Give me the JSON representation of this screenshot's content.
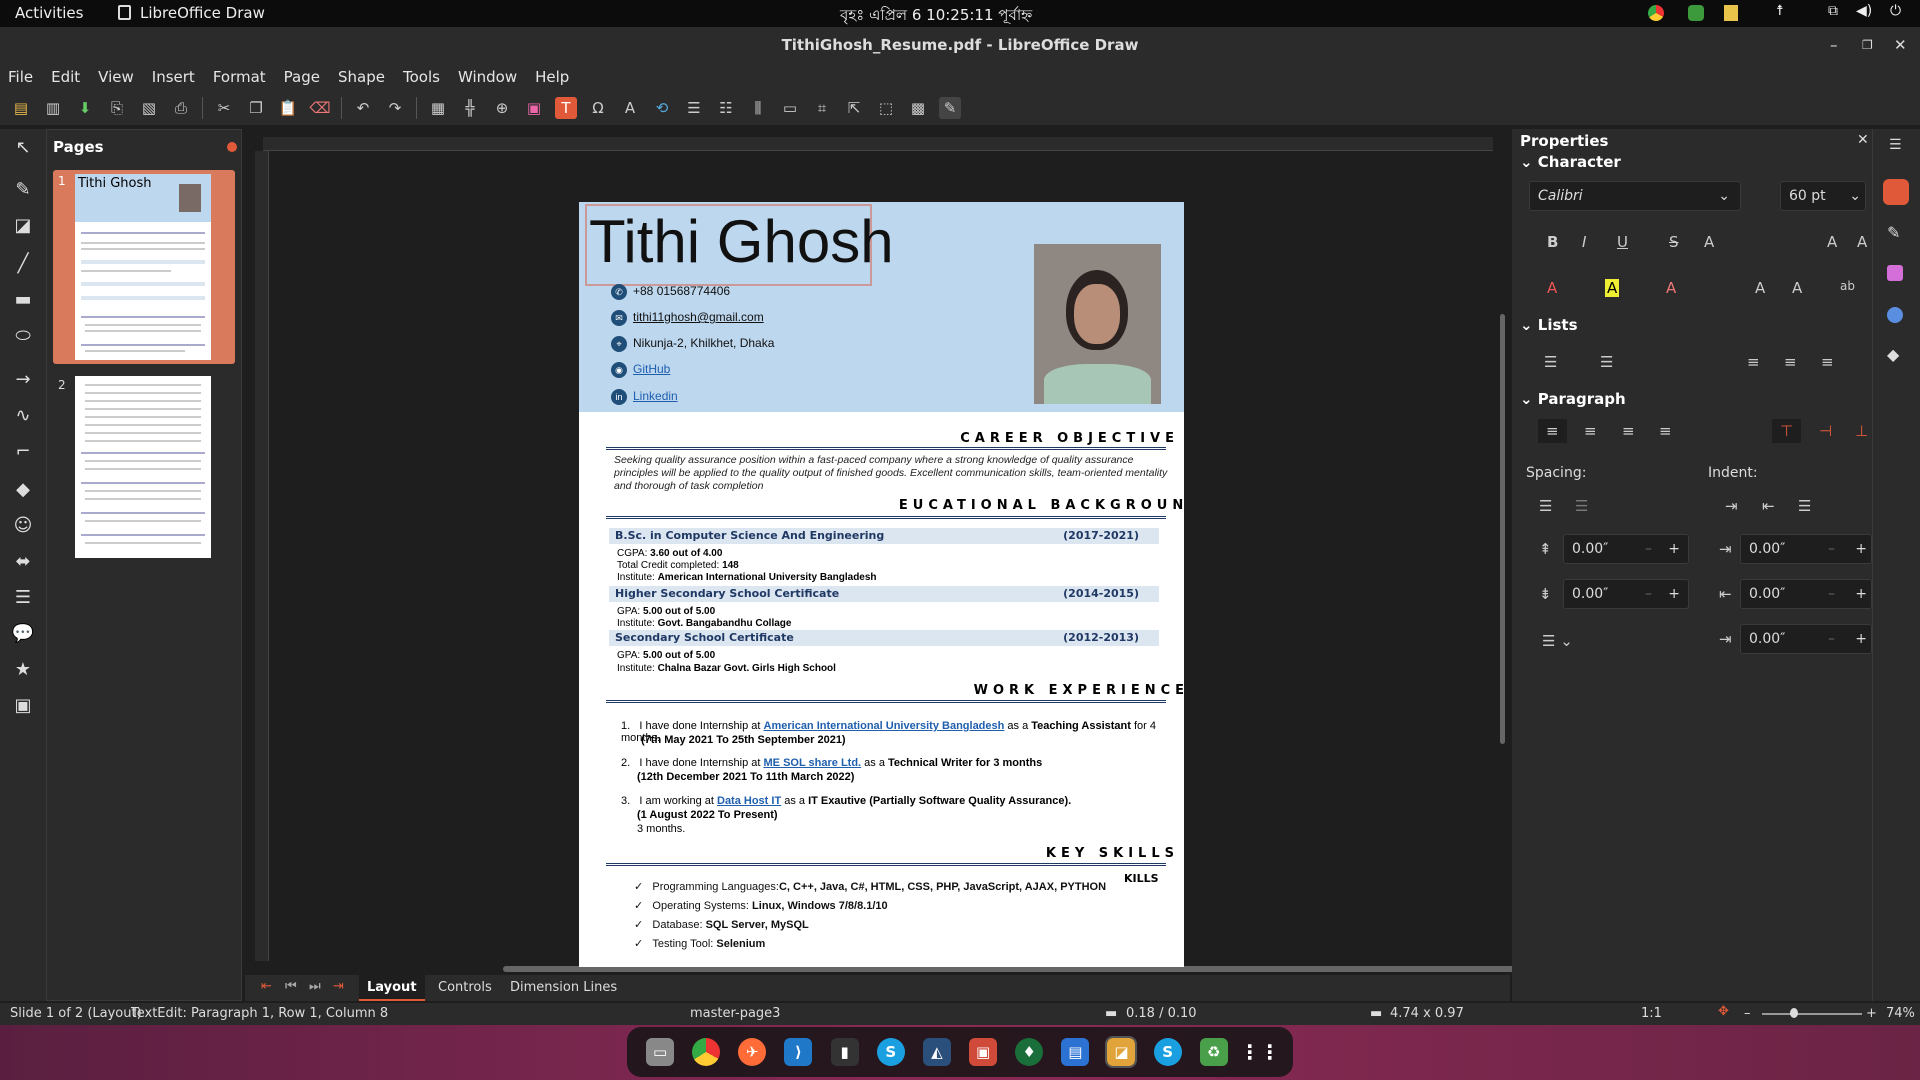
{
  "topbar": {
    "activities": "Activities",
    "app": "LibreOffice Draw",
    "clock": "বৃহঃ এপ্রিল 6  10:25:11 পূর্বাহ্ন"
  },
  "window": {
    "title": "TithiGhosh_Resume.pdf - LibreOffice Draw"
  },
  "menu": [
    "File",
    "Edit",
    "View",
    "Insert",
    "Format",
    "Page",
    "Shape",
    "Tools",
    "Window",
    "Help"
  ],
  "pages_panel": {
    "title": "Pages",
    "thumb1_num": "1",
    "thumb2_num": "2",
    "thumb1_name": "Tithi Ghosh"
  },
  "resume": {
    "name": "Tithi Ghosh",
    "phone": "+88 01568774406",
    "email": "tithi11ghosh@gmail.com",
    "address": "Nikunja-2, Khilkhet, Dhaka",
    "github": "GitHub",
    "linkedin": "Linkedin",
    "career_head": "CAREER OBJECTIVE",
    "career_text": "Seeking quality assurance position within a fast-paced company where a strong knowledge of quality assurance principles will be applied to the quality output of finished goods. Excellent communication skills, team-oriented mentality and thorough of task completion",
    "edu_head": "EUCATIONAL BACKGROUND",
    "edu": [
      {
        "title": "B.Sc. in Computer Science And Engineering",
        "years": "(2017-2021)",
        "l1a": "CGPA: ",
        "l1b": "3.60 out of 4.00",
        "l2a": "Total Credit completed: ",
        "l2b": "148",
        "l3a": "Institute: ",
        "l3b": "American International University Bangladesh"
      },
      {
        "title": "Higher Secondary School Certificate",
        "years": "(2014-2015)",
        "l1a": "GPA: ",
        "l1b": "5.00 out of 5.00",
        "l2a": "Institute: ",
        "l2b": "Govt. Bangabandhu Collage"
      },
      {
        "title": "Secondary School Certificate",
        "years": "(2012-2013)",
        "l1a": "GPA: ",
        "l1b": "5.00 out of 5.00",
        "l2a": "Institute: ",
        "l2b": "Chalna Bazar Govt. Girls High School"
      }
    ],
    "work_head": "WORK EXPERIENCE",
    "work": [
      {
        "n": "1.",
        "pre": "I have done Internship at ",
        "org": "American International University Bangladesh",
        "mid": " as a ",
        "role": "Teaching Assistant",
        "post": " for 4 months.",
        "dates": "(7th May 2021 To 25th September 2021)"
      },
      {
        "n": "2.",
        "pre": "I have done Internship at ",
        "org": "ME SOL share Ltd.",
        "mid": " as a ",
        "role": "Technical Writer",
        "post": " for 3 months",
        "dates": "(12th December 2021  To  11th March 2022)"
      },
      {
        "n": "3.",
        "pre": "I am working  at ",
        "org": "Data Host IT",
        "mid": " as a ",
        "role": "IT Exautive (Partially Software Quality Assurance).",
        "post": "",
        "dates": "(1 August 2022 To Present)",
        "extra": "3 months."
      }
    ],
    "skills_head": "KEY SKILLS",
    "skills_stray": "KILLS",
    "skills": [
      {
        "a": "Programming Languages:",
        "b": "C, C++, Java, C#, HTML, CSS, PHP, JavaScript, AJAX, PYTHON"
      },
      {
        "a": "Operating Systems: ",
        "b": "Linux, Windows 7/8/8.1/10"
      },
      {
        "a": "Database: ",
        "b": "SQL Server, MySQL"
      },
      {
        "a": "Testing Tool: ",
        "b": "Selenium"
      }
    ]
  },
  "tabs": {
    "layout": "Layout",
    "controls": "Controls",
    "dimension": "Dimension Lines"
  },
  "sidebar": {
    "title": "Properties",
    "character": "Character",
    "font": "Calibri",
    "size": "60 pt",
    "lists": "Lists",
    "paragraph": "Paragraph",
    "spacing": "Spacing:",
    "indent": "Indent:",
    "v1": "0.00″",
    "v2": "0.00″",
    "v3": "0.00″",
    "v4": "0.00″",
    "v5": "0.00″"
  },
  "status": {
    "slide": "Slide 1 of 2 (Layout)",
    "edit": "TextEdit: Paragraph 1, Row 1, Column 8",
    "master": "master-page3",
    "pos": "0.18 / 0.10",
    "size": "4.74 x 0.97",
    "scale": "1:1",
    "zoom": "74%"
  }
}
